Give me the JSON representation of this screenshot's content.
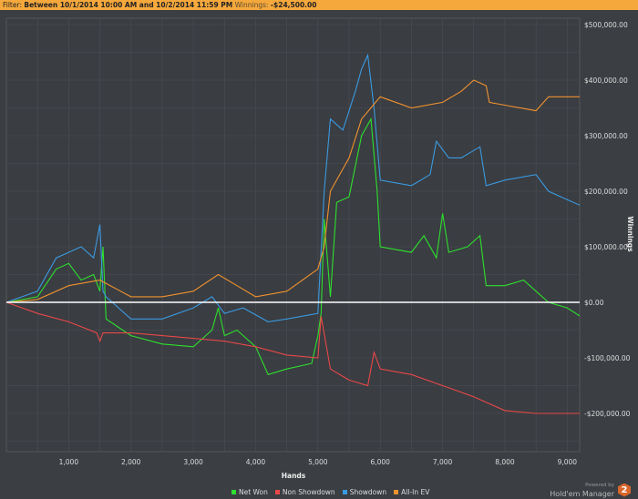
{
  "filter": {
    "label": "Filter:",
    "range": "Between 10/1/2014 10:00 AM and 10/2/2014 11:59 PM",
    "winnings_label": "Winnings:",
    "winnings_value": "-$24,500.00"
  },
  "brand": {
    "powered": "Powered by",
    "name": "Hold'em Manager",
    "badge": "2"
  },
  "chart_data": {
    "type": "line",
    "title": "",
    "xlabel": "Hands",
    "ylabel": "Winnings",
    "xlim": [
      0,
      9200
    ],
    "ylim": [
      -250000,
      520000
    ],
    "xticks": [
      1000,
      2000,
      3000,
      4000,
      5000,
      6000,
      7000,
      8000,
      9000
    ],
    "xtick_labels": [
      "1,000",
      "2,000",
      "3,000",
      "4,000",
      "5,000",
      "6,000",
      "7,000",
      "8,000",
      "9,000"
    ],
    "yticks": [
      -200000,
      -100000,
      0,
      100000,
      200000,
      300000,
      400000,
      500000
    ],
    "ytick_labels": [
      "-$200,000.00",
      "-$100,000.00",
      "$0.00",
      "$100,000.00",
      "$200,000.00",
      "$300,000.00",
      "$400,000.00",
      "$500,000.00"
    ],
    "grid": true,
    "legend": "bottom-left",
    "series": [
      {
        "name": "Net Won",
        "color": "#2ee02e",
        "x": [
          0,
          500,
          800,
          1000,
          1200,
          1400,
          1500,
          1550,
          1600,
          2000,
          2500,
          3000,
          3300,
          3400,
          3500,
          3700,
          4000,
          4200,
          4500,
          4900,
          5000,
          5050,
          5100,
          5200,
          5300,
          5500,
          5700,
          5850,
          5950,
          6000,
          6500,
          6700,
          6900,
          7000,
          7100,
          7400,
          7600,
          7700,
          8000,
          8300,
          8500,
          8700,
          9000,
          9200
        ],
        "y": [
          0,
          10000,
          60000,
          70000,
          40000,
          50000,
          20000,
          100000,
          -30000,
          -60000,
          -75000,
          -80000,
          -50000,
          -10000,
          -60000,
          -50000,
          -80000,
          -130000,
          -120000,
          -110000,
          -60000,
          -20000,
          150000,
          10000,
          180000,
          190000,
          300000,
          330000,
          200000,
          100000,
          90000,
          120000,
          80000,
          160000,
          90000,
          100000,
          120000,
          30000,
          30000,
          40000,
          20000,
          0,
          -10000,
          -24500
        ]
      },
      {
        "name": "Non Showdown",
        "color": "#e84848",
        "x": [
          0,
          500,
          1000,
          1450,
          1500,
          1550,
          2000,
          3000,
          3500,
          4000,
          4500,
          5000,
          5050,
          5200,
          5500,
          5800,
          5900,
          6000,
          6500,
          7000,
          7500,
          7800,
          8000,
          8500,
          9200
        ],
        "y": [
          0,
          -20000,
          -35000,
          -55000,
          -70000,
          -55000,
          -55000,
          -65000,
          -70000,
          -80000,
          -95000,
          -100000,
          -25000,
          -120000,
          -140000,
          -150000,
          -90000,
          -120000,
          -130000,
          -150000,
          -170000,
          -185000,
          -195000,
          -200000,
          -200000
        ]
      },
      {
        "name": "Showdown",
        "color": "#3a9ae0",
        "x": [
          0,
          500,
          800,
          1000,
          1200,
          1400,
          1500,
          1550,
          1600,
          2000,
          2500,
          3000,
          3300,
          3500,
          3800,
          4200,
          4500,
          5000,
          5100,
          5200,
          5400,
          5600,
          5700,
          5800,
          5900,
          6000,
          6500,
          6800,
          6900,
          7100,
          7300,
          7600,
          7700,
          8000,
          8500,
          8700,
          9000,
          9200
        ],
        "y": [
          0,
          20000,
          80000,
          90000,
          100000,
          80000,
          140000,
          20000,
          10000,
          -30000,
          -30000,
          -10000,
          10000,
          -20000,
          -10000,
          -35000,
          -30000,
          -20000,
          200000,
          330000,
          310000,
          380000,
          420000,
          445000,
          350000,
          220000,
          210000,
          230000,
          290000,
          260000,
          260000,
          280000,
          210000,
          220000,
          230000,
          200000,
          185000,
          175000
        ]
      },
      {
        "name": "All-In EV",
        "color": "#f0922e",
        "x": [
          0,
          500,
          1000,
          1500,
          2000,
          2500,
          3000,
          3400,
          3700,
          4000,
          4500,
          5000,
          5100,
          5200,
          5500,
          5700,
          5850,
          6000,
          6500,
          7000,
          7300,
          7500,
          7700,
          7750,
          8000,
          8500,
          8700,
          9200
        ],
        "y": [
          0,
          5000,
          30000,
          40000,
          10000,
          10000,
          20000,
          50000,
          30000,
          10000,
          20000,
          60000,
          100000,
          200000,
          260000,
          330000,
          350000,
          370000,
          350000,
          360000,
          380000,
          400000,
          390000,
          360000,
          355000,
          345000,
          370000,
          370000
        ]
      }
    ]
  }
}
